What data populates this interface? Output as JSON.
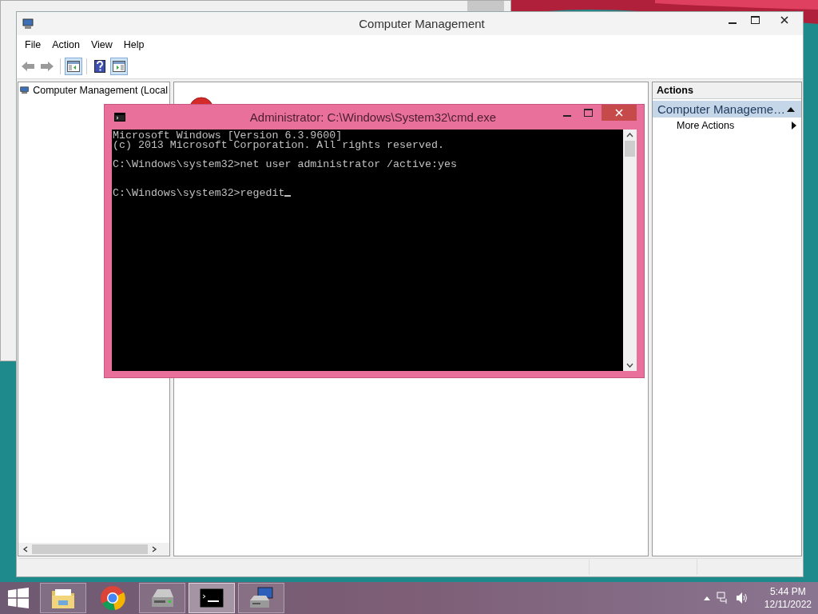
{
  "main_window": {
    "title": "Computer Management",
    "menu": [
      "File",
      "Action",
      "View",
      "Help"
    ],
    "toolbar": [
      {
        "kind": "back",
        "pressed": false
      },
      {
        "kind": "forward",
        "pressed": false
      },
      {
        "kind": "console-tree",
        "pressed": true
      },
      {
        "kind": "help",
        "pressed": false
      },
      {
        "kind": "action-pane",
        "pressed": true
      }
    ],
    "tree": [
      {
        "label": "Computer Management (Local",
        "selected": false
      }
    ],
    "actions": {
      "header": "Actions",
      "section": "Computer Manageme…",
      "items": [
        "More Actions"
      ]
    }
  },
  "console": {
    "title": "Administrator: C:\\Windows\\System32\\cmd.exe",
    "lines": [
      {
        "kind": "text",
        "text": "Microsoft Windows [Version 6.3.9600]",
        "cursor": false
      },
      {
        "kind": "text",
        "text": "(c) 2013 Microsoft Corporation. All rights reserved.",
        "cursor": false
      },
      {
        "kind": "blank"
      },
      {
        "kind": "text",
        "text": "C:\\Windows\\system32>net user administrator /active:yes",
        "cursor": false
      },
      {
        "kind": "blank"
      },
      {
        "kind": "blank"
      },
      {
        "kind": "text",
        "text": "C:\\Windows\\system32>regedit",
        "cursor": true
      }
    ]
  },
  "taskbar": {
    "apps": [
      {
        "kind": "explorer",
        "selected": false
      },
      {
        "kind": "browser",
        "selected": false
      },
      {
        "kind": "disk",
        "selected": false
      },
      {
        "kind": "console",
        "selected": true
      },
      {
        "kind": "management",
        "selected": false
      }
    ],
    "time": "5:44 PM",
    "date": "12/11/2022"
  }
}
